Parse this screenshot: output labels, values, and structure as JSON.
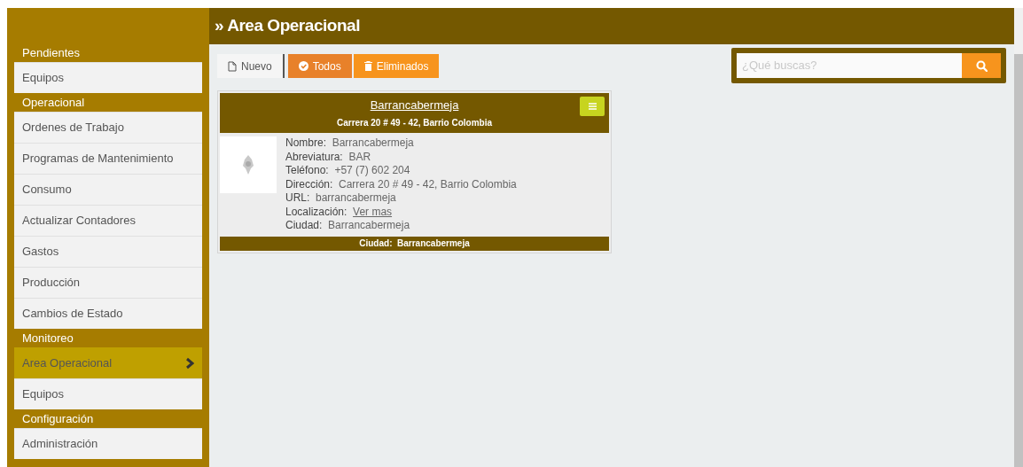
{
  "page_title": "» Area Operacional",
  "sidebar": [
    {
      "heading": "Pendientes",
      "items": [
        {
          "label": "Equipos",
          "selected": false
        }
      ]
    },
    {
      "heading": "Operacional",
      "items": [
        {
          "label": "Ordenes de Trabajo",
          "selected": false
        },
        {
          "label": "Programas de Mantenimiento",
          "selected": false
        },
        {
          "label": "Consumo",
          "selected": false
        },
        {
          "label": "Actualizar Contadores",
          "selected": false
        },
        {
          "label": "Gastos",
          "selected": false
        },
        {
          "label": "Producción",
          "selected": false
        },
        {
          "label": "Cambios de Estado",
          "selected": false
        }
      ]
    },
    {
      "heading": "Monitoreo",
      "items": [
        {
          "label": "Area Operacional",
          "selected": true
        },
        {
          "label": "Equipos",
          "selected": false
        }
      ]
    },
    {
      "heading": "Configuración",
      "items": [
        {
          "label": "Administración",
          "selected": false
        }
      ]
    }
  ],
  "toolbar": [
    {
      "kind": "new",
      "label": "Nuevo"
    },
    {
      "kind": "all",
      "label": "Todos"
    },
    {
      "kind": "deleted",
      "label": "Eliminados"
    }
  ],
  "search": {
    "placeholder": "¿Qué buscas?"
  },
  "card": {
    "title": "Barrancabermeja",
    "subtitle": "Carrera 20 # 49 - 42, Barrio Colombia",
    "fields": [
      {
        "label": "Nombre:",
        "value": "Barrancabermeja"
      },
      {
        "label": "Abreviatura:",
        "value": "BAR"
      },
      {
        "label": "Teléfono:",
        "value": "+57 (7) 602 204"
      },
      {
        "label": "Dirección:",
        "value": "Carrera 20 # 49 - 42, Barrio Colombia"
      },
      {
        "label": "URL:",
        "value": "barrancabermeja"
      },
      {
        "label": "Localización:",
        "value": "Ver mas",
        "kind": "link"
      },
      {
        "label": "Ciudad:",
        "value": "Barrancabermeja"
      }
    ],
    "footer": "Ciudad:  Barrancabermeja"
  }
}
